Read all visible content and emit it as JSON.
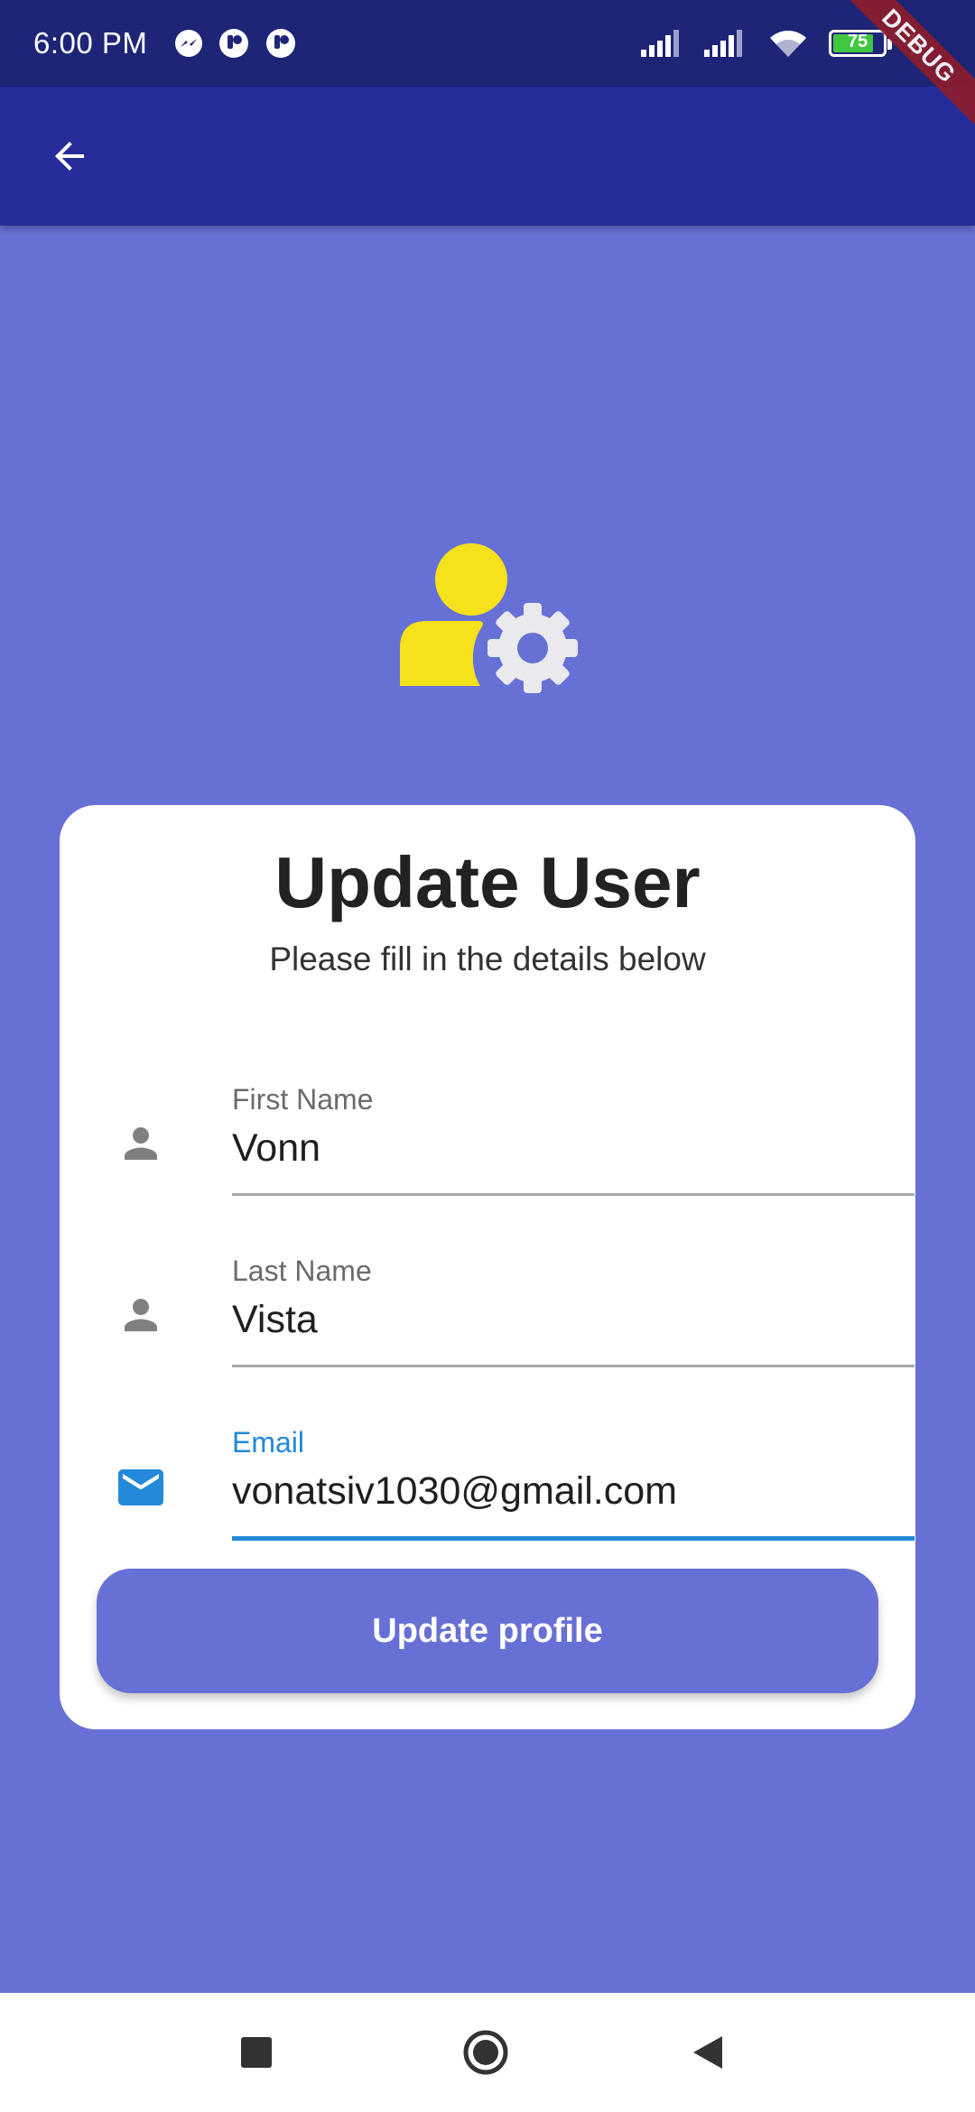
{
  "status_bar": {
    "time": "6:00 PM",
    "battery_level": "75",
    "left_icons": [
      "messenger-icon",
      "notification-app-icon",
      "notification-app-icon"
    ],
    "right_icons": [
      "signal-icon",
      "signal-icon",
      "wifi-icon",
      "battery-charging-icon"
    ]
  },
  "debug_banner": "DEBUG",
  "app_bar": {
    "back_icon": "arrow-back-icon"
  },
  "hero": {
    "icon": "user-settings-icon",
    "colors": {
      "person": "#f5e11c",
      "gear": "#e9e9ee"
    }
  },
  "card": {
    "title": "Update User",
    "subtitle": "Please fill in the details below",
    "fields": [
      {
        "label": "First Name",
        "value": "Vonn",
        "icon": "person-icon",
        "focused": false
      },
      {
        "label": "Last Name",
        "value": "Vista",
        "icon": "person-icon",
        "focused": false
      },
      {
        "label": "Email",
        "value": "vonatsiv1030@gmail.com",
        "icon": "email-icon",
        "focused": true
      }
    ],
    "submit_label": "Update profile"
  },
  "nav_bar": {
    "buttons": [
      "recents-icon",
      "home-icon",
      "back-icon"
    ]
  },
  "colors": {
    "background": "#6770d4",
    "app_bar": "#262d9a",
    "status_bar": "#1e2577",
    "accent": "#2389d8",
    "debug": "#8b1d2c"
  }
}
